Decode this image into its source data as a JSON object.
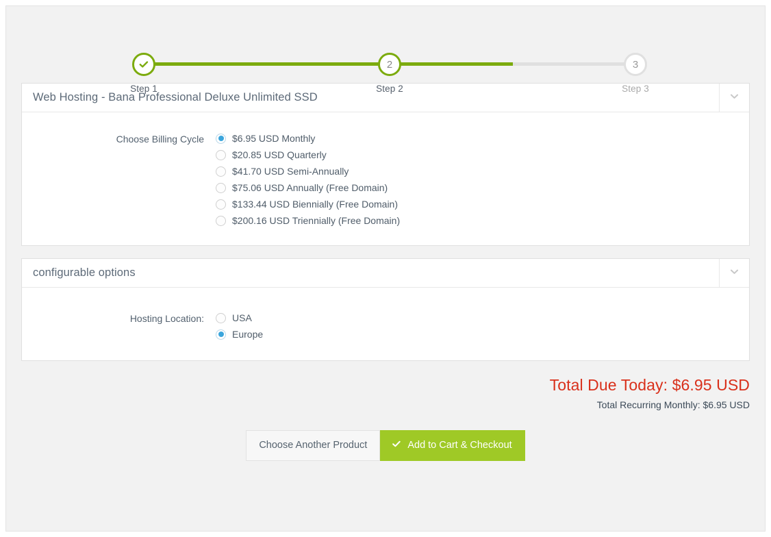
{
  "wizard": {
    "steps": [
      {
        "label": "Step 1",
        "marker": "check",
        "state": "done"
      },
      {
        "label": "Step 2",
        "marker": "2",
        "state": "active"
      },
      {
        "label": "Step 3",
        "marker": "3",
        "state": "todo"
      }
    ]
  },
  "product_panel": {
    "title": "Web Hosting - Bana Professional Deluxe Unlimited SSD",
    "toggle_icon": "chevron-down-icon",
    "billing": {
      "label": "Choose Billing Cycle",
      "options": [
        {
          "text": "$6.95 USD Monthly",
          "selected": true
        },
        {
          "text": "$20.85 USD Quarterly",
          "selected": false
        },
        {
          "text": "$41.70 USD Semi-Annually",
          "selected": false
        },
        {
          "text": "$75.06 USD Annually (Free Domain)",
          "selected": false
        },
        {
          "text": "$133.44 USD Biennially (Free Domain)",
          "selected": false
        },
        {
          "text": "$200.16 USD Triennially (Free Domain)",
          "selected": false
        }
      ]
    }
  },
  "config_panel": {
    "title": "configurable options",
    "toggle_icon": "chevron-down-icon",
    "hosting_location": {
      "label": "Hosting Location:",
      "options": [
        {
          "text": "USA",
          "selected": false
        },
        {
          "text": "Europe",
          "selected": true
        }
      ]
    }
  },
  "totals": {
    "due_today": "Total Due Today: $6.95 USD",
    "recurring": "Total Recurring Monthly: $6.95 USD"
  },
  "actions": {
    "secondary_label": "Choose Another Product",
    "primary_label": "Add to Cart & Checkout",
    "primary_icon": "check-icon"
  },
  "colors": {
    "green_track": "#7cab0e",
    "green_button": "#9fc926",
    "radio_blue": "#3aa5dc",
    "total_red": "#d9301b"
  }
}
